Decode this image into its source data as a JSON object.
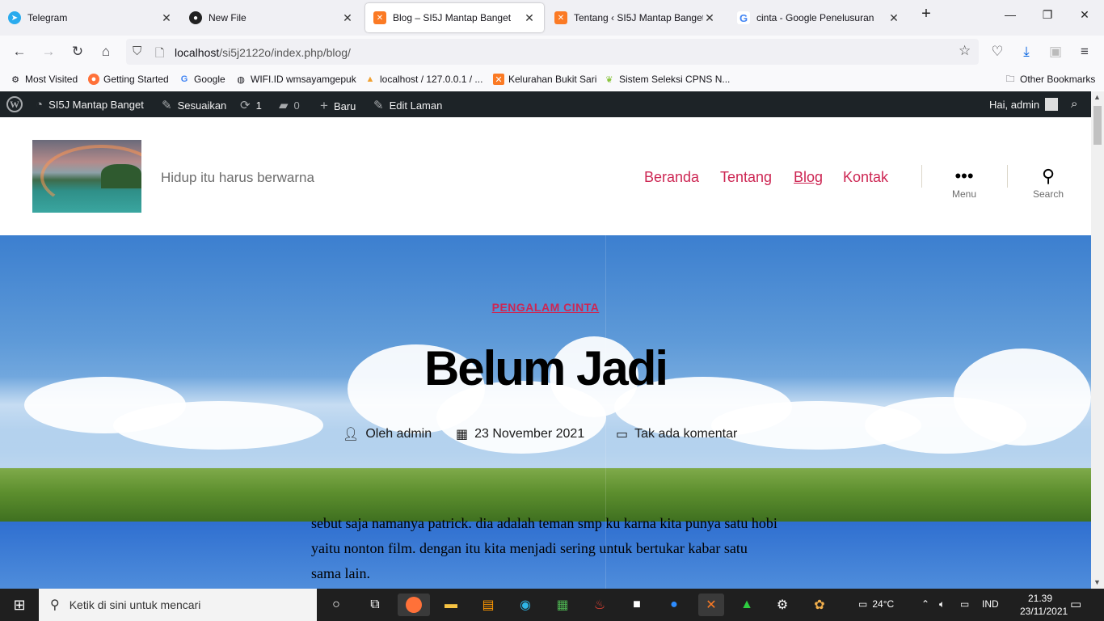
{
  "browser": {
    "tabs": [
      {
        "title": "Telegram",
        "icon": "telegram-icon",
        "color": "#2aabee"
      },
      {
        "title": "New File",
        "icon": "github-icon",
        "color": "#222222"
      },
      {
        "title": "Blog – SI5J Mantap Banget",
        "icon": "xampp-icon",
        "color": "#fb7a24",
        "active": true
      },
      {
        "title": "Tentang ‹ SI5J Mantap Banget —",
        "icon": "xampp-icon",
        "color": "#fb7a24"
      },
      {
        "title": "cinta - Google Penelusuran",
        "icon": "google-icon",
        "color": "#4285f4"
      }
    ],
    "url_host": "localhost",
    "url_path": "/si5j2122o/index.php/blog/",
    "bookmarks": [
      {
        "label": "Most Visited",
        "icon": "gear-icon"
      },
      {
        "label": "Getting Started",
        "icon": "firefox-icon"
      },
      {
        "label": "Google",
        "icon": "google-icon"
      },
      {
        "label": "WIFI.ID wmsayamgepuk",
        "icon": "globe-icon"
      },
      {
        "label": "localhost / 127.0.0.1 / ...",
        "icon": "phpmyadmin-icon"
      },
      {
        "label": "Kelurahan Bukit Sari",
        "icon": "xampp-icon"
      },
      {
        "label": "Sistem Seleksi CPNS N...",
        "icon": "leaf-icon"
      }
    ],
    "other_bookmarks": "Other Bookmarks"
  },
  "adminbar": {
    "site_name": "SI5J Mantap Banget",
    "customize": "Sesuaikan",
    "updates": "1",
    "comments": "0",
    "new": "Baru",
    "edit": "Edit Laman",
    "greeting": "Hai, admin"
  },
  "header": {
    "tagline": "Hidup itu harus berwarna",
    "menu": [
      {
        "label": "Beranda"
      },
      {
        "label": "Tentang"
      },
      {
        "label": "Blog",
        "current": true
      },
      {
        "label": "Kontak"
      }
    ],
    "menu_toggle": "Menu",
    "search_toggle": "Search"
  },
  "post": {
    "category": "PENGALAM CINTA",
    "title": "Belum Jadi",
    "author": "Oleh admin",
    "date": "23 November 2021",
    "comments": "Tak ada komentar",
    "body": "sebut saja namanya patrick. dia adalah teman smp ku karna kita punya satu hobi yaitu nonton film. dengan itu kita menjadi sering untuk bertukar kabar satu sama lain."
  },
  "taskbar": {
    "search_placeholder": "Ketik di sini untuk mencari",
    "weather": "24°C",
    "language": "IND",
    "time": "21.39",
    "date": "23/11/2021"
  },
  "colors": {
    "accent": "#cd2653",
    "adminbar": "#1d2327",
    "taskbar": "#1f1f1f"
  }
}
